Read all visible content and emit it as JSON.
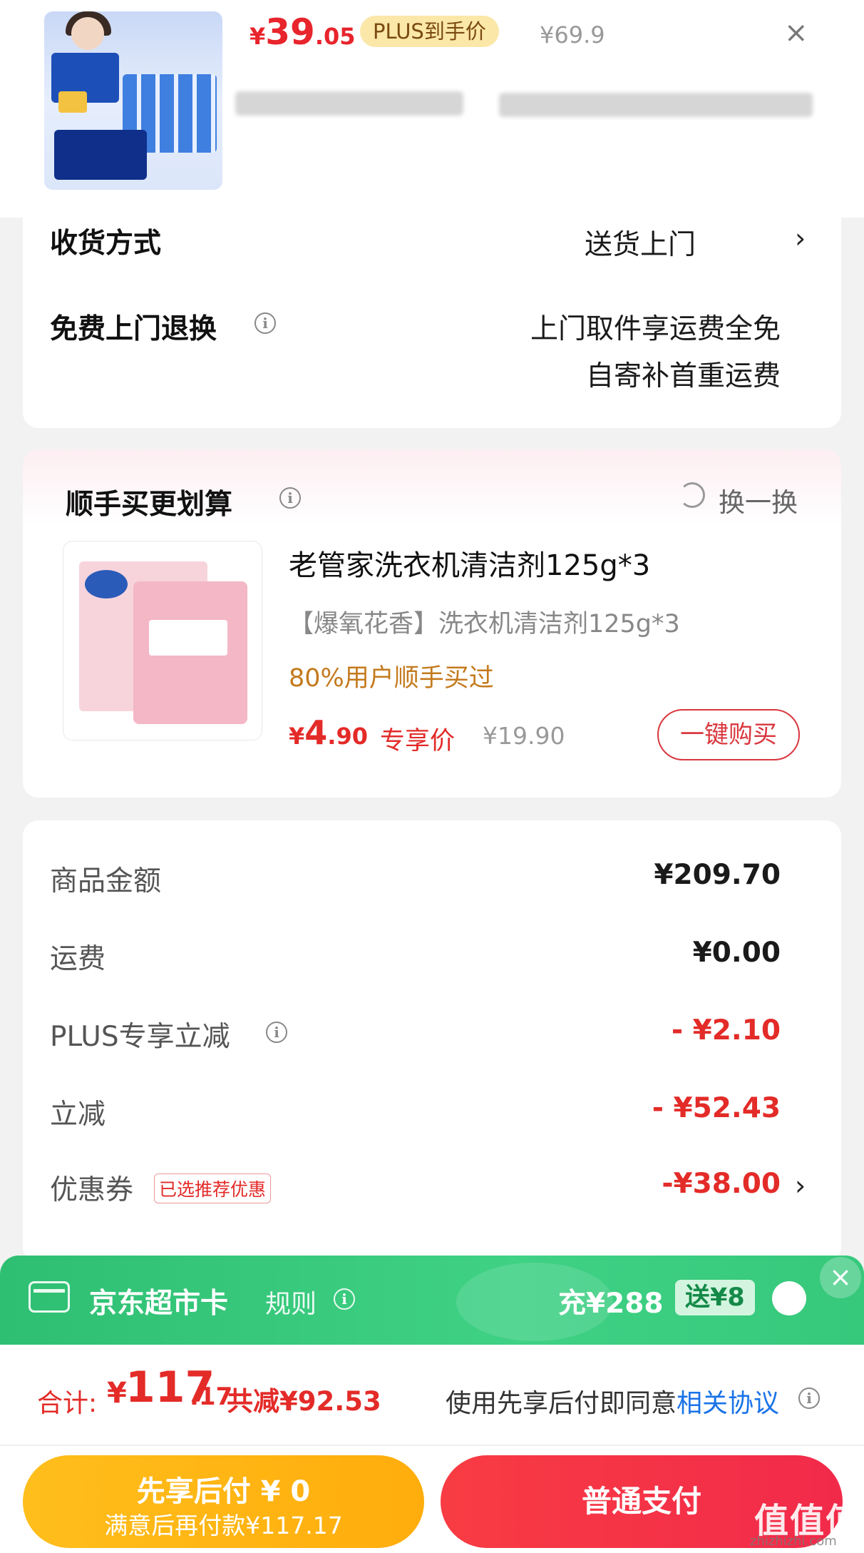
{
  "top": {
    "price_currency": "¥",
    "price_int": "39",
    "price_dec": ".05",
    "plus_badge": "PLUS到手价",
    "original_price": "¥69.9",
    "close_icon": "×"
  },
  "delivery": {
    "method_label": "收货方式",
    "method_value": "送货上门",
    "return_label": "免费上门退换",
    "return_line1": "上门取件享运费全免",
    "return_line2": "自寄补首重运费"
  },
  "addon": {
    "title": "顺手买更划算",
    "refresh_label": "换一换",
    "product_name": "老管家洗衣机清洁剂125g*3",
    "product_variant": "【爆氧花香】洗衣机清洁剂125g*3",
    "popularity": "80%用户顺手买过",
    "price_currency": "¥",
    "price_int": "4",
    "price_dec": ".90",
    "price_tag": "专享价",
    "original_price": "¥19.90",
    "buy_button": "一键购买"
  },
  "summary": {
    "items": [
      {
        "label": "商品金额",
        "value": "¥209.70"
      },
      {
        "label": "运费",
        "value": "¥0.00"
      },
      {
        "label": "PLUS专享立减",
        "value": "- ¥2.10"
      },
      {
        "label": "立减",
        "value": "- ¥52.43"
      },
      {
        "label": "优惠券",
        "value": "-¥38.00"
      }
    ],
    "coupon_tag": "已选推荐优惠"
  },
  "market_card": {
    "title": "京东超市卡",
    "rule": "规则",
    "charge": "充¥288",
    "gift": "送¥8",
    "close": "×"
  },
  "footer": {
    "total_label": "合计:",
    "total_currency": "¥",
    "total_int": "117",
    "total_dec": ".17",
    "total_saved": "共减¥92.53",
    "agree_text": "使用先享后付即同意",
    "agree_link": "相关协议",
    "later_pay_title": "先享后付 ¥ 0",
    "later_pay_sub": "满意后再付款¥117.17",
    "pay_button": "普通支付"
  },
  "watermark": {
    "text": "值值值",
    "sub": "zhizhizhi.com"
  },
  "colors": {
    "accent_red": "#e32b28",
    "plus_gold": "#fbe7a8",
    "green": "#36c87b",
    "yellow": "#ffb714",
    "link": "#1a73e8"
  }
}
